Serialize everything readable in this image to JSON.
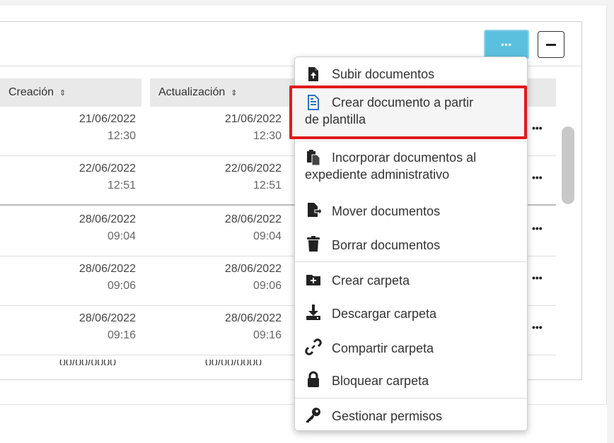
{
  "table": {
    "columns": [
      {
        "label": "Creación",
        "sort_icon": "⇕"
      },
      {
        "label": "Actualización",
        "sort_icon": "⇕"
      }
    ],
    "rows": [
      {
        "created_date": "21/06/2022",
        "created_time": "12:30",
        "updated_date": "21/06/2022",
        "updated_time": "12:30"
      },
      {
        "created_date": "22/06/2022",
        "created_time": "12:51",
        "updated_date": "22/06/2022",
        "updated_time": "12:51"
      },
      {
        "created_date": "28/06/2022",
        "created_time": "09:04",
        "updated_date": "28/06/2022",
        "updated_time": "09:04"
      },
      {
        "created_date": "28/06/2022",
        "created_time": "09:06",
        "updated_date": "28/06/2022",
        "updated_time": "09:06"
      },
      {
        "created_date": "28/06/2022",
        "created_time": "09:16",
        "updated_date": "28/06/2022",
        "updated_time": "09:16"
      }
    ],
    "row_actions": "•••"
  },
  "toolbar": {
    "more_label": "•••"
  },
  "menu": {
    "items": [
      {
        "label": "Subir documentos",
        "icon": "file-upload-icon"
      },
      {
        "label_line1": "Crear documento a partir",
        "label_line2": "de plantilla",
        "icon": "file-template-icon",
        "highlighted": true
      },
      {
        "label_line1": "Incorporar documentos al",
        "label_line2": "expediente administrativo",
        "icon": "paste-document-icon"
      },
      {
        "label": "Mover documentos",
        "icon": "move-file-icon"
      },
      {
        "label": "Borrar documentos",
        "icon": "trash-icon"
      },
      {
        "label": "Crear carpeta",
        "icon": "folder-plus-icon"
      },
      {
        "label": "Descargar carpeta",
        "icon": "download-icon"
      },
      {
        "label": "Compartir carpeta",
        "icon": "link-icon"
      },
      {
        "label": "Bloquear carpeta",
        "icon": "lock-icon"
      },
      {
        "label": "Gestionar permisos",
        "icon": "key-icon"
      }
    ]
  },
  "colors": {
    "accent": "#5bc0de",
    "highlight_border": "#e01b1b",
    "header_bg": "#e9e9e9"
  }
}
